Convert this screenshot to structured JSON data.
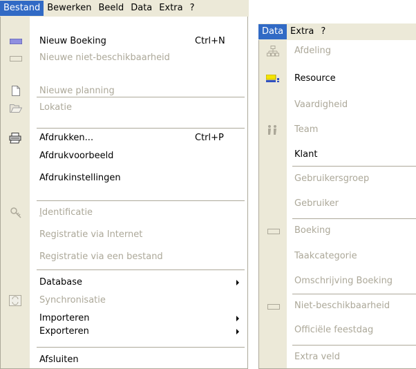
{
  "left_menubar": {
    "items": [
      "Bestand",
      "Bewerken",
      "Beeld",
      "Data",
      "Extra",
      "?"
    ]
  },
  "bestand_menu": {
    "items": [
      {
        "label": "Nieuw Boeking",
        "shortcut": "Ctrl+N",
        "icon": "new-booking-icon"
      },
      {
        "label": "Nieuwe niet-beschikbaarheid",
        "icon": "unavailability-icon"
      },
      {
        "label": "Nieuwe planning",
        "icon": "new-document-icon"
      },
      {
        "label": "Lokatie",
        "icon": "open-folder-icon"
      },
      {
        "label": "Afdrukken...",
        "shortcut": "Ctrl+P",
        "icon": "printer-icon"
      },
      {
        "label": "Afdrukvoorbeeld"
      },
      {
        "label": "Afdrukinstellingen"
      },
      {
        "label_underlined": "I",
        "label_rest": "dentificatie",
        "icon": "key-icon"
      },
      {
        "label": "Registratie via Internet"
      },
      {
        "label": "Registratie via een bestand"
      },
      {
        "label": "Database"
      },
      {
        "label": "Synchronisatie",
        "icon": "sync-icon"
      },
      {
        "label": "Importeren"
      },
      {
        "label": "Exporteren"
      },
      {
        "label": "Afsluiten"
      }
    ]
  },
  "right_menubar": {
    "items": [
      "Data",
      "Extra",
      "?"
    ]
  },
  "data_menu": {
    "items": [
      {
        "label": "Afdeling",
        "icon": "organization-tree-icon"
      },
      {
        "label": "Resource",
        "icon": "resource-icon"
      },
      {
        "label": "Vaardigheid"
      },
      {
        "label": "Team",
        "icon": "team-icon"
      },
      {
        "label": "Klant"
      },
      {
        "label": "Gebruikersgroep"
      },
      {
        "label": "Gebruiker"
      },
      {
        "label": "Boeking",
        "icon": "booking-icon"
      },
      {
        "label": "Taakcategorie"
      },
      {
        "label": "Omschrijving Boeking"
      },
      {
        "label": "Niet-beschikbaarheid",
        "icon": "unavailability-icon"
      },
      {
        "label": "Officiële feestdag"
      },
      {
        "label": "Extra veld"
      }
    ]
  },
  "colors": {
    "menu_bg": "#ffffff",
    "gutter_bg": "#ece9d8",
    "highlight": "#316ac5",
    "disabled_text": "#aca899",
    "separator": "#aca899"
  }
}
